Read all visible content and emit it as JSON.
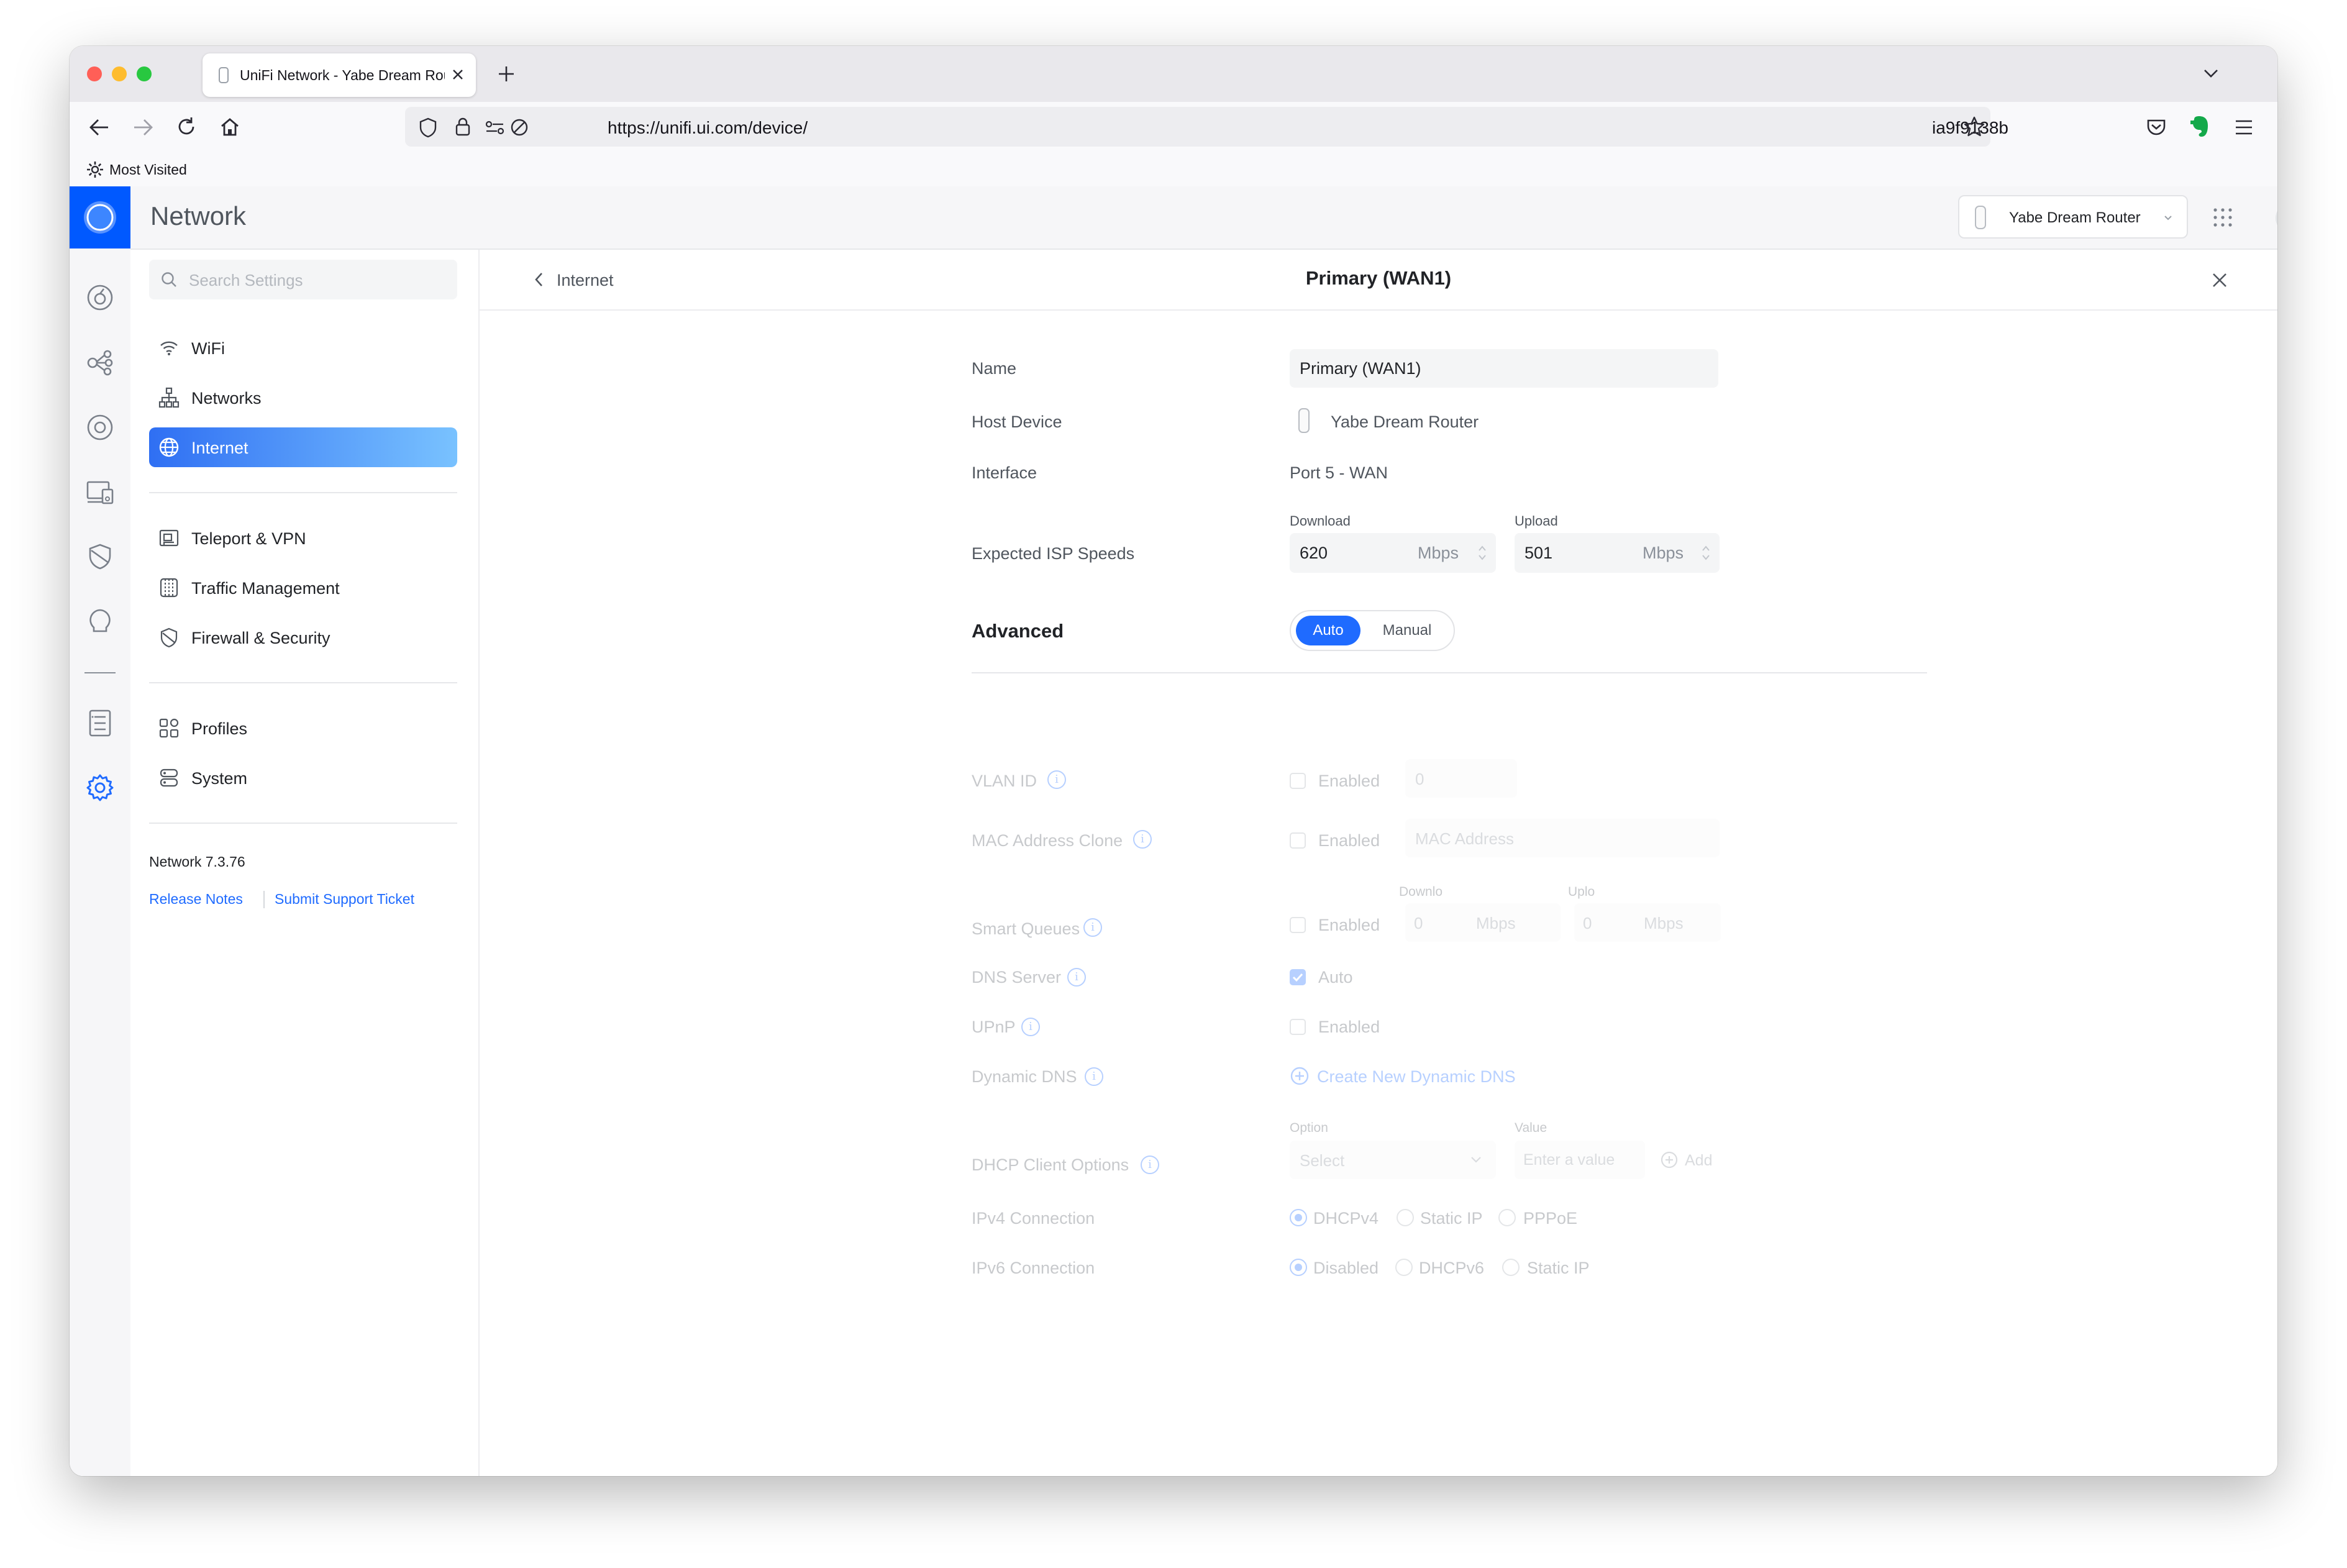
{
  "browser": {
    "tab_title": "UniFi Network - Yabe Dream Router",
    "url": "https://unifi.ui.com/device/",
    "url_tail": "ia9f9138b",
    "bookmark": "Most Visited",
    "colors": {
      "close": "#ff5f57",
      "minimize": "#febc2e",
      "zoom": "#28c840"
    }
  },
  "header": {
    "app_name": "Network",
    "device_selector": "Yabe Dream Router",
    "brand_color": "#0059ff"
  },
  "rail": {
    "icons": [
      "dashboard-icon",
      "topology-icon",
      "devices-icon",
      "clients-icon",
      "security-icon",
      "insights-icon",
      "logs-icon",
      "settings-icon"
    ]
  },
  "sidebar": {
    "search_placeholder": "Search Settings",
    "items": [
      {
        "label": "WiFi",
        "icon": "wifi-icon"
      },
      {
        "label": "Networks",
        "icon": "networks-icon"
      },
      {
        "label": "Internet",
        "icon": "globe-icon",
        "active": true
      },
      {
        "label": "Teleport & VPN",
        "icon": "teleport-icon"
      },
      {
        "label": "Traffic Management",
        "icon": "traffic-icon"
      },
      {
        "label": "Firewall & Security",
        "icon": "shield-icon"
      },
      {
        "label": "Profiles",
        "icon": "profiles-icon"
      },
      {
        "label": "System",
        "icon": "system-icon"
      }
    ],
    "version": "Network 7.3.76",
    "release_notes": "Release Notes",
    "support": "Submit Support Ticket"
  },
  "page": {
    "back_label": "Internet",
    "title": "Primary (WAN1)"
  },
  "form": {
    "name_label": "Name",
    "name_value": "Primary (WAN1)",
    "host_label": "Host Device",
    "host_value": "Yabe Dream Router",
    "interface_label": "Interface",
    "interface_value": "Port 5 - WAN",
    "isp_label": "Expected ISP Speeds",
    "download_label": "Download",
    "download_value": "620",
    "upload_label": "Upload",
    "upload_value": "501",
    "unit": "Mbps",
    "advanced_label": "Advanced",
    "auto_label": "Auto",
    "manual_label": "Manual",
    "accent": "#1f6bff"
  },
  "advanced": {
    "vlan_label": "VLAN ID",
    "vlan_enabled": "Enabled",
    "vlan_value": "0",
    "mac_label": "MAC Address Clone",
    "mac_enabled": "Enabled",
    "mac_placeholder": "MAC Address",
    "sq_label": "Smart Queues",
    "sq_enabled": "Enabled",
    "sq_download_label": "Downlo",
    "sq_upload_label": "Uplo",
    "sq_download": "0",
    "sq_upload": "0",
    "unit": "Mbps",
    "dns_label": "DNS Server",
    "dns_auto": "Auto",
    "upnp_label": "UPnP",
    "upnp_enabled": "Enabled",
    "ddns_label": "Dynamic DNS",
    "ddns_create": "Create New Dynamic DNS",
    "dhcp_label": "DHCP Client Options",
    "option_label": "Option",
    "value_label": "Value",
    "select_placeholder": "Select",
    "value_placeholder": "Enter a value",
    "add_label": "Add",
    "ipv4_label": "IPv4 Connection",
    "ipv4_opt1": "DHCPv4",
    "ipv4_opt2": "Static IP",
    "ipv4_opt3": "PPPoE",
    "ipv6_label": "IPv6 Connection",
    "ipv6_opt1": "Disabled",
    "ipv6_opt2": "DHCPv6",
    "ipv6_opt3": "Static IP"
  }
}
